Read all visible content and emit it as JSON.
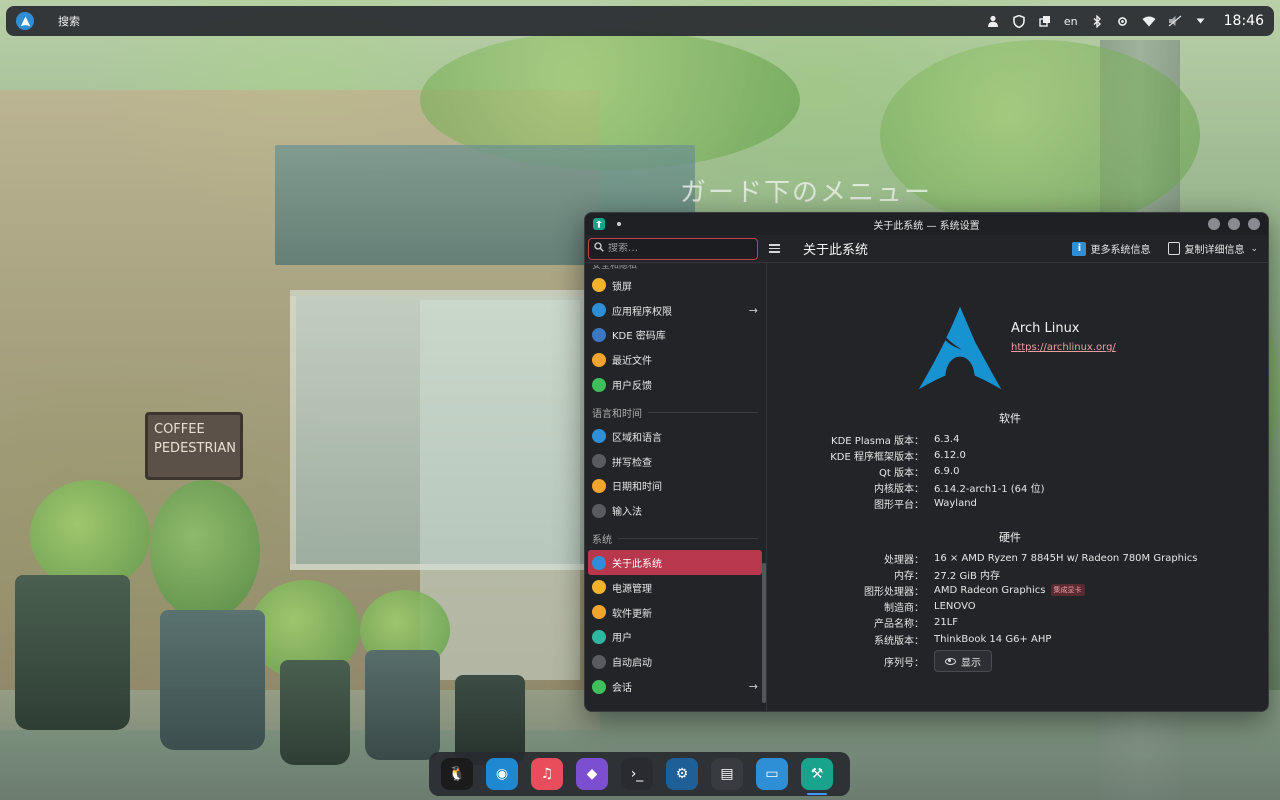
{
  "wallpaper": {
    "sign_text": "ガード下のメニュー",
    "coffee_sign": [
      "COFFEE",
      "PEDESTRIAN"
    ]
  },
  "top_panel": {
    "search_label": "搜索",
    "keyboard_layout": "en",
    "clock": "18:46",
    "icons": [
      "user-icon",
      "shield-icon",
      "windows-icon",
      "bluetooth-icon",
      "brightness-icon",
      "wifi-icon",
      "volume-muted-icon",
      "tray-expand-icon"
    ]
  },
  "window": {
    "title": "关于此系统 — 系统设置",
    "search_placeholder": "搜索…",
    "page_title": "关于此系统",
    "more_info_label": "更多系统信息",
    "copy_details_label": "复制详细信息"
  },
  "sidebar": {
    "cut_heading": "安全和隐私",
    "groups": [
      {
        "heading": "",
        "items": [
          {
            "label": "锁屏",
            "icon": "lock-icon",
            "color": "#f2b22e",
            "arrow": false
          },
          {
            "label": "应用程序权限",
            "icon": "app-permissions-icon",
            "color": "#2e8fd6",
            "arrow": true
          },
          {
            "label": "KDE 密码库",
            "icon": "wallet-icon",
            "color": "#3a78c2",
            "arrow": false
          },
          {
            "label": "最近文件",
            "icon": "recent-files-icon",
            "color": "#f2a52e",
            "arrow": false
          },
          {
            "label": "用户反馈",
            "icon": "feedback-icon",
            "color": "#3fbf5a",
            "arrow": false
          }
        ]
      },
      {
        "heading": "语言和时间",
        "items": [
          {
            "label": "区域和语言",
            "icon": "region-language-icon",
            "color": "#2e8fd6",
            "arrow": false
          },
          {
            "label": "拼写检查",
            "icon": "spellcheck-icon",
            "color": "#5a5b60",
            "arrow": false
          },
          {
            "label": "日期和时间",
            "icon": "clock-icon",
            "color": "#f2a52e",
            "arrow": false
          },
          {
            "label": "输入法",
            "icon": "keyboard-icon",
            "color": "#5a5b60",
            "arrow": false
          }
        ]
      },
      {
        "heading": "系统",
        "items": [
          {
            "label": "关于此系统",
            "icon": "info-icon",
            "color": "#2e8fd6",
            "arrow": false,
            "active": true
          },
          {
            "label": "电源管理",
            "icon": "power-icon",
            "color": "#f2b22e",
            "arrow": false
          },
          {
            "label": "软件更新",
            "icon": "update-icon",
            "color": "#f2a52e",
            "arrow": false
          },
          {
            "label": "用户",
            "icon": "users-icon",
            "color": "#2fb5a0",
            "arrow": false
          },
          {
            "label": "自动启动",
            "icon": "autostart-icon",
            "color": "#5a5b60",
            "arrow": false
          },
          {
            "label": "会话",
            "icon": "session-icon",
            "color": "#3fbf5a",
            "arrow": true
          }
        ]
      }
    ]
  },
  "about": {
    "distro_name": "Arch Linux",
    "distro_url": "https://archlinux.org/",
    "software_heading": "软件",
    "software": [
      {
        "key": "KDE Plasma 版本：",
        "value": "6.3.4"
      },
      {
        "key": "KDE 程序框架版本：",
        "value": "6.12.0"
      },
      {
        "key": "Qt 版本：",
        "value": "6.9.0"
      },
      {
        "key": "内核版本：",
        "value": "6.14.2-arch1-1 (64 位)"
      },
      {
        "key": "图形平台：",
        "value": "Wayland"
      }
    ],
    "hardware_heading": "硬件",
    "hardware": [
      {
        "key": "处理器：",
        "value": "16 × AMD Ryzen 7 8845H w/ Radeon 780M Graphics"
      },
      {
        "key": "内存：",
        "value": "27.2 GiB 内存"
      },
      {
        "key": "图形处理器：",
        "value": "AMD Radeon Graphics",
        "badge": "集成显卡"
      },
      {
        "key": "制造商：",
        "value": "LENOVO"
      },
      {
        "key": "产品名称：",
        "value": "21LF"
      },
      {
        "key": "系统版本：",
        "value": "ThinkBook 14 G6+ AHP"
      }
    ],
    "serial_key": "序列号：",
    "show_label": "显示"
  },
  "dock": {
    "apps": [
      {
        "name": "qq",
        "icon": "qq-icon",
        "color": "#1b1b1b"
      },
      {
        "name": "edge",
        "icon": "edge-icon",
        "color": "#1e88d0"
      },
      {
        "name": "music",
        "icon": "music-icon",
        "color": "#e84d5b"
      },
      {
        "name": "obsidian",
        "icon": "obsidian-icon",
        "color": "#7b4fd0"
      },
      {
        "name": "terminal",
        "icon": "terminal-icon",
        "color": "#2a2b30"
      },
      {
        "name": "steam",
        "icon": "steam-icon",
        "color": "#1e5f98"
      },
      {
        "name": "system-monitor",
        "icon": "system-monitor-icon",
        "color": "#3a3b40"
      },
      {
        "name": "files",
        "icon": "folder-icon",
        "color": "#2e8fd6"
      },
      {
        "name": "system-settings",
        "icon": "settings-app-icon",
        "color": "#19a38d",
        "active": true
      }
    ]
  }
}
